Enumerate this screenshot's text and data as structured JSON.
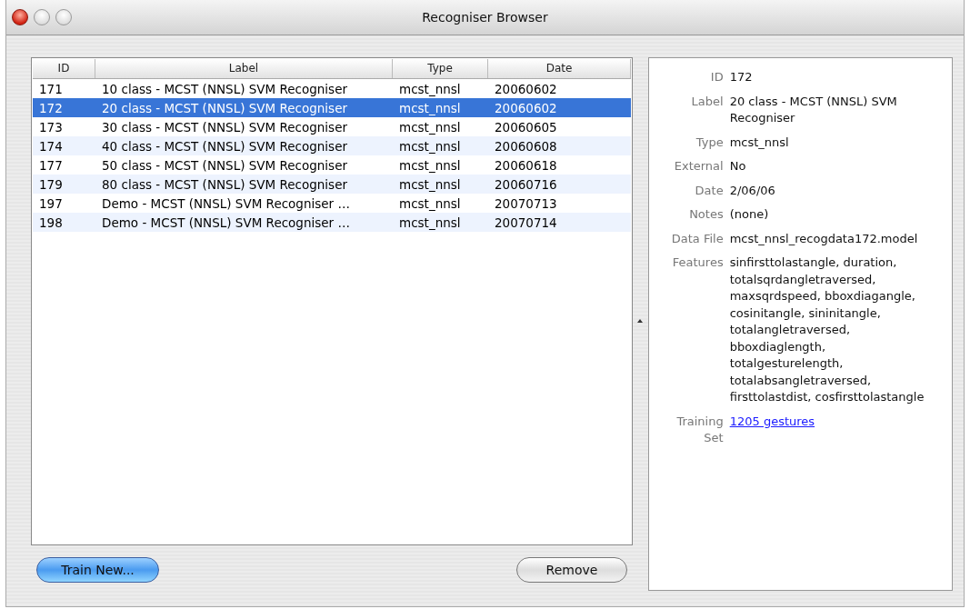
{
  "window": {
    "title": "Recogniser Browser"
  },
  "table": {
    "columns": [
      "ID",
      "Label",
      "Type",
      "Date"
    ],
    "rows": [
      {
        "cells": [
          "171",
          "10 class - MCST (NNSL) SVM Recogniser",
          "mcst_nnsl",
          "20060602"
        ],
        "selected": false
      },
      {
        "cells": [
          "172",
          "20 class - MCST (NNSL) SVM Recogniser",
          "mcst_nnsl",
          "20060602"
        ],
        "selected": true
      },
      {
        "cells": [
          "173",
          "30 class - MCST (NNSL) SVM Recogniser",
          "mcst_nnsl",
          "20060605"
        ],
        "selected": false
      },
      {
        "cells": [
          "174",
          "40 class - MCST (NNSL) SVM Recogniser",
          "mcst_nnsl",
          "20060608"
        ],
        "selected": false
      },
      {
        "cells": [
          "177",
          "50 class - MCST (NNSL) SVM Recogniser",
          "mcst_nnsl",
          "20060618"
        ],
        "selected": false
      },
      {
        "cells": [
          "179",
          "80 class - MCST (NNSL) SVM Recogniser",
          "mcst_nnsl",
          "20060716"
        ],
        "selected": false
      },
      {
        "cells": [
          "197",
          "Demo - MCST (NNSL) SVM Recogniser …",
          "mcst_nnsl",
          "20070713"
        ],
        "selected": false
      },
      {
        "cells": [
          "198",
          "Demo - MCST (NNSL) SVM Recogniser …",
          "mcst_nnsl",
          "20070714"
        ],
        "selected": false
      }
    ]
  },
  "buttons": [
    {
      "label": "Train New...",
      "kind": "default"
    },
    {
      "label": "Remove",
      "kind": "normal"
    }
  ],
  "details": [
    {
      "label": "ID",
      "value": "172",
      "kind": "text"
    },
    {
      "label": "Label",
      "value": "20 class - MCST (NNSL) SVM Recogniser",
      "kind": "text"
    },
    {
      "label": "Type",
      "value": "mcst_nnsl",
      "kind": "text"
    },
    {
      "label": "External",
      "value": "No",
      "kind": "text"
    },
    {
      "label": "Date",
      "value": "2/06/06",
      "kind": "text"
    },
    {
      "label": "Notes",
      "value": "(none)",
      "kind": "text"
    },
    {
      "label": "Data File",
      "value": "mcst_nnsl_recogdata172.model",
      "kind": "text"
    },
    {
      "label": "Features",
      "value": "sinfirsttolastangle, duration, totalsqrdangletraversed, maxsqrdspeed, bboxdiagangle, cosinitangle, sininitangle, totalangletraversed, bboxdiaglength, totalgesturelength, totalabsangletraversed, firsttolastdist, cosfirsttolastangle",
      "kind": "text"
    },
    {
      "label": "Training Set",
      "value": "1205 gestures",
      "kind": "link"
    }
  ]
}
